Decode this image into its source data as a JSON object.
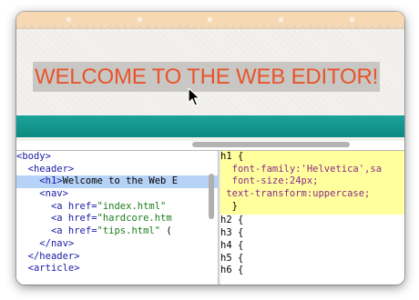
{
  "preview": {
    "heading_text": "WELCOME TO THE WEB EDITOR!",
    "accent_color": "#e8542a",
    "band_color": "#12978e"
  },
  "html_panel": {
    "lines": [
      {
        "indent": 0,
        "parts": [
          {
            "t": "tag",
            "v": "<body>"
          }
        ]
      },
      {
        "indent": 2,
        "parts": [
          {
            "t": "tag",
            "v": "<header>"
          }
        ]
      },
      {
        "indent": 4,
        "selected": true,
        "parts": [
          {
            "t": "tag",
            "v": "<h1>"
          },
          {
            "t": "txt",
            "v": "Welcome to the Web E"
          }
        ]
      },
      {
        "indent": 4,
        "parts": [
          {
            "t": "tag",
            "v": "<nav>"
          }
        ]
      },
      {
        "indent": 6,
        "parts": [
          {
            "t": "tag",
            "v": "<a "
          },
          {
            "t": "attr",
            "v": "href="
          },
          {
            "t": "str",
            "v": "\"index.html\""
          }
        ]
      },
      {
        "indent": 6,
        "parts": [
          {
            "t": "tag",
            "v": "<a "
          },
          {
            "t": "attr",
            "v": "href="
          },
          {
            "t": "str",
            "v": "\"hardcore.htm"
          }
        ]
      },
      {
        "indent": 6,
        "parts": [
          {
            "t": "tag",
            "v": "<a "
          },
          {
            "t": "attr",
            "v": "href="
          },
          {
            "t": "str",
            "v": "\"tips.html\""
          },
          {
            "t": "txt",
            "v": " ("
          }
        ]
      },
      {
        "indent": 4,
        "parts": [
          {
            "t": "tag",
            "v": "</nav>"
          }
        ]
      },
      {
        "indent": 2,
        "parts": [
          {
            "t": "tag",
            "v": "</header>"
          }
        ]
      },
      {
        "indent": 2,
        "parts": [
          {
            "t": "tag",
            "v": "<article>"
          }
        ]
      }
    ]
  },
  "css_panel": {
    "active_rule": {
      "selector": "h1 {",
      "declarations": [
        {
          "prop": "font-family:",
          "val": "'Helvetica',sa",
          "indent": 2
        },
        {
          "prop": "font-size:",
          "val": "24px;",
          "indent": 2
        },
        {
          "prop": "text-transform:",
          "val": "uppercase;",
          "indent": 1
        }
      ],
      "close": "}"
    },
    "other_rules": [
      "h2 {",
      "h3 {",
      "h4 {",
      "h5 {",
      "h6 {"
    ]
  }
}
